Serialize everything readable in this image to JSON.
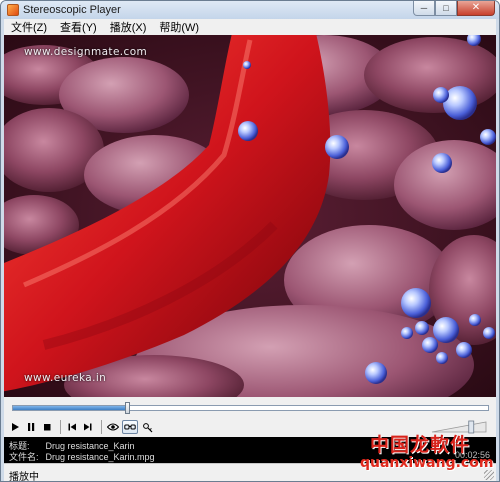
{
  "window": {
    "title": "Stereoscopic Player",
    "buttons": {
      "minimize": "─",
      "maximize": "□",
      "close": "✕"
    }
  },
  "menu": [
    {
      "label": "文件(Z)"
    },
    {
      "label": "查看(Y)"
    },
    {
      "label": "播放(X)"
    },
    {
      "label": "帮助(W)"
    }
  ],
  "video": {
    "watermark_top": "www.designmate.com",
    "watermark_bottom": "www.eureka.in"
  },
  "seek": {
    "progress": 0.24
  },
  "controls": {
    "icons": [
      "play-icon",
      "pause-icon",
      "stop-icon",
      "previous-icon",
      "next-icon",
      "eye-icon",
      "stereo-glasses-icon",
      "settings-icon"
    ],
    "volume_level": 0.75
  },
  "info": {
    "title_label": "标题:",
    "title_value": "Drug resistance_Karin",
    "file_label": "文件名:",
    "file_value": "Drug resistance_Karin.mpg",
    "time": "00:02:56"
  },
  "status": {
    "text": "播放中"
  },
  "site_watermark": {
    "chinese": "中国龙軟件",
    "url": "quanxiwang.com"
  },
  "colors": {
    "vessel": "#c4131b",
    "tissue": "#9a4a6a",
    "bubble": "#8aa6ff",
    "seek_fill": "#3f7fc4",
    "watermark_red": "#d8231b"
  }
}
